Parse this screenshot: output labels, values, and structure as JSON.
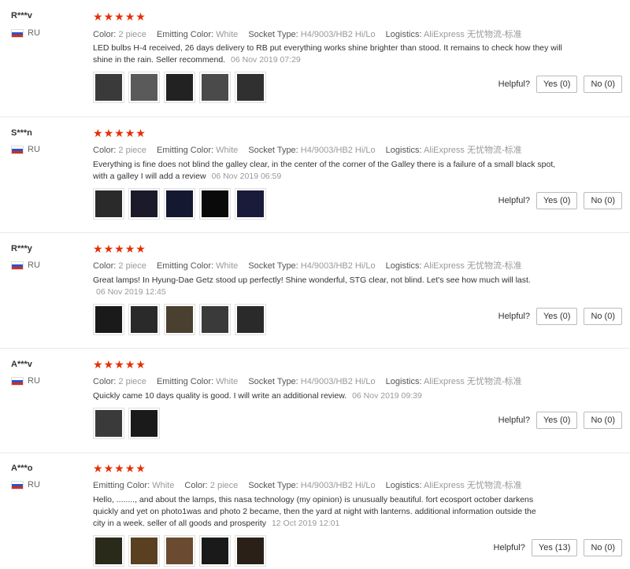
{
  "labels": {
    "color": "Color:",
    "emitting_color": "Emitting Color:",
    "socket_type": "Socket Type:",
    "logistics": "Logistics:",
    "helpful": "Helpful?"
  },
  "reviews": [
    {
      "user": "R***v",
      "country": "RU",
      "rating": 5,
      "color": "2 piece",
      "emitting_color": "White",
      "socket_type": "H4/9003/HB2 Hi/Lo",
      "logistics": "AliExpress 无忧物流-标准",
      "text": "LED bulbs H-4 received, 26 days delivery to RB put everything works shine brighter than stood. It remains to check how they will shine in the rain. Seller recommend.",
      "date": "06 Nov 2019 07:29",
      "yes": "Yes (0)",
      "no": "No (0)",
      "photos": [
        "#3a3a3a",
        "#5a5a5a",
        "#222222",
        "#4a4a4a",
        "#303030"
      ]
    },
    {
      "user": "S***n",
      "country": "RU",
      "rating": 5,
      "color": "2 piece",
      "emitting_color": "White",
      "socket_type": "H4/9003/HB2 Hi/Lo",
      "logistics": "AliExpress 无忧物流-标准",
      "text": "Everything is fine does not blind the galley clear, in the center of the corner of the Galley there is a failure of a small black spot, with a galley I will add a review",
      "date": "06 Nov 2019 06:59",
      "yes": "Yes (0)",
      "no": "No (0)",
      "photos": [
        "#2a2a2a",
        "#1a1a2a",
        "#141830",
        "#0a0a0a",
        "#1a1a3a"
      ]
    },
    {
      "user": "R***y",
      "country": "RU",
      "rating": 5,
      "color": "2 piece",
      "emitting_color": "White",
      "socket_type": "H4/9003/HB2 Hi/Lo",
      "logistics": "AliExpress 无忧物流-标准",
      "text": "Great lamps! In Hyung-Dae Getz stood up perfectly! Shine wonderful, STG clear, not blind. Let's see how much will last.",
      "date": "06 Nov 2019 12:45",
      "yes": "Yes (0)",
      "no": "No (0)",
      "photos": [
        "#1a1a1a",
        "#2a2a2a",
        "#4a4030",
        "#3a3a3a",
        "#2a2a2a"
      ]
    },
    {
      "user": "A***v",
      "country": "RU",
      "rating": 5,
      "color": "2 piece",
      "emitting_color": "White",
      "socket_type": "H4/9003/HB2 Hi/Lo",
      "logistics": "AliExpress 无忧物流-标准",
      "text": "Quickly came 10 days quality is good. I will write an additional review.",
      "date": "06 Nov 2019 09:39",
      "yes": "Yes (0)",
      "no": "No (0)",
      "photos": [
        "#3a3a3a",
        "#1a1a1a"
      ]
    },
    {
      "user": "A***o",
      "country": "RU",
      "rating": 5,
      "emitting_color": "White",
      "color": "2 piece",
      "socket_type": "H4/9003/HB2 Hi/Lo",
      "logistics": "AliExpress 无忧物流-标准",
      "text": "Hello, ........, and about the lamps, this nasa technology (my opinion) is unusually beautiful. fort ecosport october darkens quickly and yet on photo1was and photo 2 became, then the yard at night with lanterns. additional information outside the city in a week. seller of all goods and prosperity",
      "date": "12 Oct 2019 12:01",
      "yes": "Yes (13)",
      "no": "No (0)",
      "photos": [
        "#2a2a1a",
        "#5a4020",
        "#6a4a30",
        "#1a1a1a",
        "#2a2018"
      ]
    }
  ]
}
